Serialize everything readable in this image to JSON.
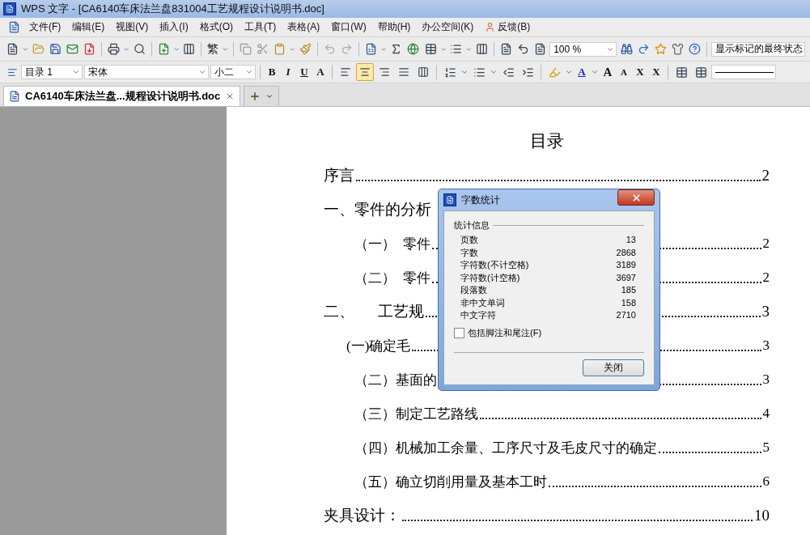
{
  "window": {
    "title": "WPS 文字 - [CA6140车床法兰盘831004工艺规程设计说明书.doc]"
  },
  "menu": [
    {
      "label": "文件(F)"
    },
    {
      "label": "编辑(E)"
    },
    {
      "label": "视图(V)"
    },
    {
      "label": "插入(I)"
    },
    {
      "label": "格式(O)"
    },
    {
      "label": "工具(T)"
    },
    {
      "label": "表格(A)"
    },
    {
      "label": "窗口(W)"
    },
    {
      "label": "帮助(H)"
    },
    {
      "label": "办公空间(K)"
    },
    {
      "label": "反馈(B)",
      "kind": "feedback"
    }
  ],
  "toolbar": {
    "zoom": "100 %",
    "markup_view": "显示标记的最终状态",
    "convert_label": "繁"
  },
  "format_bar": {
    "style": "目录 1",
    "font": "宋体",
    "size": "小二",
    "text_buttons": [
      {
        "label": "B",
        "kind": "bold"
      },
      {
        "label": "I",
        "kind": "italic"
      },
      {
        "label": "U",
        "kind": "underline"
      },
      {
        "label": "A",
        "kind": "effect"
      }
    ],
    "align_buttons": [
      {
        "kind": "left",
        "selected": false
      },
      {
        "kind": "center",
        "selected": true
      },
      {
        "kind": "right",
        "selected": false
      },
      {
        "kind": "justify",
        "selected": false
      },
      {
        "kind": "distribute",
        "selected": false
      }
    ],
    "font_color_label": "A",
    "size_buttons": [
      {
        "label": "A",
        "kind": "grow"
      },
      {
        "label": "A",
        "kind": "shrink"
      },
      {
        "label": "X",
        "kind": "sup"
      },
      {
        "label": "X",
        "kind": "sub"
      }
    ]
  },
  "tabs": [
    {
      "label": "CA6140车床法兰盘...规程设计说明书.doc",
      "selected": true
    }
  ],
  "document": {
    "heading": "目录",
    "toc": [
      {
        "text": "序言",
        "page": "2"
      },
      {
        "text": "一、零件的分析",
        "children": [
          {
            "text": "（一）  零件",
            "page": "2"
          },
          {
            "text": "（二）  零件",
            "page": "2"
          }
        ]
      },
      {
        "text": "二、      工艺规",
        "page": "3",
        "children": [
          {
            "text": "(一)确定毛",
            "page": "3",
            "kind": "tight"
          },
          {
            "text": "（二）基面的",
            "page": "3"
          },
          {
            "text": "（三）制定工艺路线",
            "page": "4"
          },
          {
            "text": "（四）机械加工余量、工序尺寸及毛皮尺寸的确定",
            "page": "5"
          },
          {
            "text": "（五）确立切削用量及基本工时",
            "page": "6"
          }
        ]
      },
      {
        "text": "夹具设计：",
        "page": "10"
      }
    ]
  },
  "dialog": {
    "title": "字数统计",
    "group": "统计信息",
    "stats": [
      {
        "label": "页数",
        "value": "13"
      },
      {
        "label": "字数",
        "value": "2868"
      },
      {
        "label": "字符数(不计空格)",
        "value": "3189"
      },
      {
        "label": "字符数(计空格)",
        "value": "3697"
      },
      {
        "label": "段落数",
        "value": "185"
      },
      {
        "label": "非中文单词",
        "value": "158"
      },
      {
        "label": "中文字符",
        "value": "2710"
      }
    ],
    "checkbox": {
      "label": "包括脚注和尾注(F)",
      "checked": false
    },
    "button": "关闭"
  }
}
